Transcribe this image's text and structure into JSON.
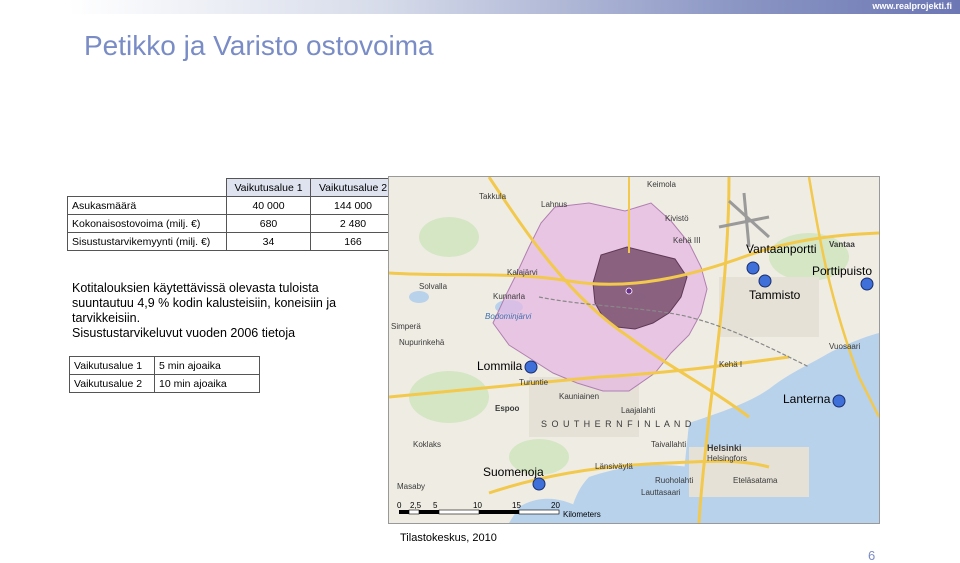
{
  "header": {
    "brand": "www.realprojekti.fi",
    "title": "Petikko ja Varisto  ostovoima"
  },
  "stats_table": {
    "columns": [
      "",
      "Vaikutusalue 1",
      "Vaikutusalue 2"
    ],
    "rows": [
      {
        "label": "Asukasmäärä",
        "v1": "40 000",
        "v2": "144 000"
      },
      {
        "label": "Kokonaisostovoima (milj. €)",
        "v1": "680",
        "v2": "2 480"
      },
      {
        "label": "Sisustustarvikemyynti (milj. €)",
        "v1": "34",
        "v2": "166"
      }
    ]
  },
  "description": {
    "line1": "Kotitalouksien käytettävissä olevasta tuloista suuntautuu 4,9 % kodin kalusteisiin, koneisiin ja tarvikkeisiin.",
    "line2": "Sisustustarvikeluvut vuoden 2006 tietoja"
  },
  "zones_table": {
    "rows": [
      {
        "zone": "Vaikutusalue 1",
        "time": "5 min ajoaika"
      },
      {
        "zone": "Vaikutusalue 2",
        "time": "10 min ajoaika"
      }
    ]
  },
  "map": {
    "places": {
      "vantaanportti": "Vantaanportti",
      "porttipuisto": "Porttipuisto",
      "tammisto": "Tammisto",
      "lommila": "Lommila",
      "lanterna": "Lanterna",
      "suomenoja": "Suomenoja"
    },
    "base_labels": {
      "keimola": "Keimola",
      "takkula": "Takkula",
      "lahnus": "Lahnus",
      "kivisto": "Kivistö",
      "vantaa": "Vantaa",
      "kunnarla": "Kunnarla",
      "kalajarvi": "Kalajärvi",
      "solvalla": "Solvalla",
      "nupurinkeha": "Nupurinkehä",
      "espoo": "Espoo",
      "kauniainen": "Kauniainen",
      "turuntie": "Turuntie",
      "helsinki": "Helsinki",
      "helsingfors": "Helsingfors",
      "taivallahti": "Taivallahti",
      "ruoholahti": "Ruoholahti",
      "etelasatama": "Eteläsatama",
      "lansivayla": "Länsiväylä",
      "koklaks": "Koklaks",
      "masaby": "Masaby",
      "bodominjarvi": "Bodominjärvi",
      "simpera": "Simperä",
      "southern_finland": "S O U T H E R N   F I N L A N D",
      "keha_iii": "Kehä III",
      "keha_i": "Kehä I",
      "laajalahti": "Laajalahti",
      "lauttasaari": "Lauttasaari",
      "vuosaari": "Vuosaari"
    },
    "scale": {
      "ticks": [
        "0",
        "2,5",
        "5",
        "10",
        "15",
        "20"
      ],
      "unit": "Kilometers"
    },
    "colors": {
      "zone1": "#7a4f6e",
      "zone2": "#e6b6e2",
      "marker": "#3f6fd8",
      "water": "#b8d2ec",
      "land": "#efece3"
    }
  },
  "source": "Tilastokeskus, 2010",
  "page_number": "6"
}
